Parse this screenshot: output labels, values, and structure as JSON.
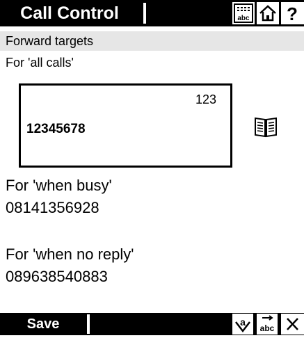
{
  "header": {
    "title": "Call Control",
    "icons": [
      "keyboard-abc-icon",
      "home-icon",
      "help-icon"
    ],
    "help_glyph": "?"
  },
  "section": {
    "title": "Forward targets"
  },
  "all_calls": {
    "label": "For 'all calls'",
    "input_mode": "123",
    "value": "12345678"
  },
  "busy": {
    "label": "For 'when busy'",
    "value": "08141356928"
  },
  "no_reply": {
    "label": "For 'when no reply'",
    "value": "089638540883"
  },
  "footer": {
    "save_label": "Save",
    "icons": [
      "mark-icon",
      "text-edit-icon",
      "close-icon"
    ]
  }
}
